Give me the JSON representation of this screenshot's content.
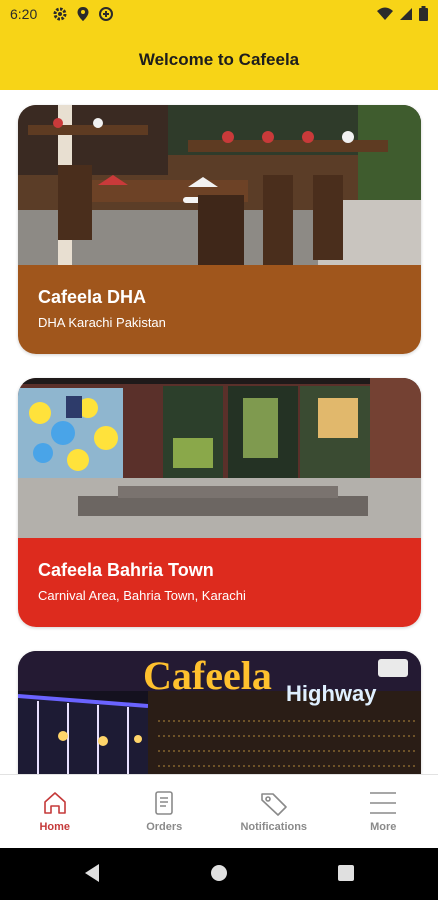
{
  "status_bar": {
    "time": "6:20",
    "left_icons": [
      "gear-icon",
      "location-icon",
      "data-saver-icon"
    ],
    "right_icons": [
      "wifi-icon",
      "signal-icon",
      "battery-icon"
    ]
  },
  "header": {
    "title": "Welcome to Cafeela"
  },
  "cards": [
    {
      "title": "Cafeela DHA",
      "subtitle": "DHA Karachi Pakistan",
      "color": "#a0561c"
    },
    {
      "title": "Cafeela Bahria Town",
      "subtitle": "Carnival Area, Bahria Town, Karachi",
      "color": "#dd2b1e"
    },
    {
      "title": "",
      "subtitle": "",
      "sign_line1": "Cafeela",
      "sign_line2": "Highway"
    }
  ],
  "bottom_nav": {
    "items": [
      {
        "label": "Home",
        "icon": "home-icon",
        "active": true
      },
      {
        "label": "Orders",
        "icon": "orders-icon",
        "active": false
      },
      {
        "label": "Notifications",
        "icon": "tag-icon",
        "active": false
      },
      {
        "label": "More",
        "icon": "menu-icon",
        "active": false
      }
    ]
  },
  "colors": {
    "header": "#f7d417",
    "active_nav": "#c53a3a",
    "inactive_nav": "#8a8a8a"
  }
}
